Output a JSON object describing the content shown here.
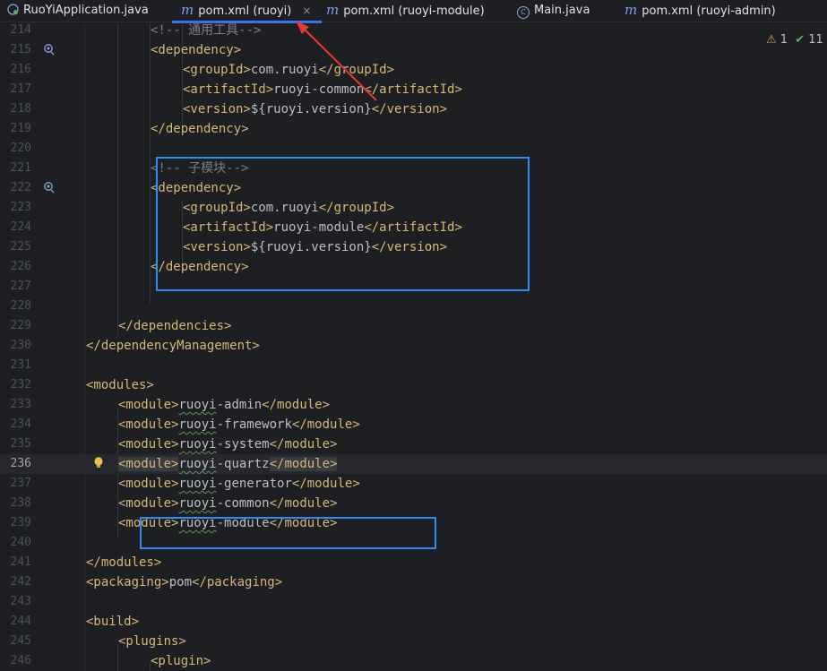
{
  "tabs": [
    {
      "label": "RuoYiApplication.java",
      "icon": "spring-java-class-icon"
    },
    {
      "label": "pom.xml (ruoyi)",
      "icon": "maven-m-icon",
      "active": true,
      "close": "×"
    },
    {
      "label": "pom.xml (ruoyi-module)",
      "icon": "maven-m-icon"
    },
    {
      "label": "Main.java",
      "icon": "java-class-c-icon",
      "glyph": "C"
    },
    {
      "label": "pom.xml (ruoyi-admin)",
      "icon": "maven-m-icon"
    }
  ],
  "inspection": {
    "warnings": "1",
    "ok": "11"
  },
  "lines": [
    {
      "n": "214",
      "text": "<!-- 通用工具-->"
    },
    {
      "n": "215",
      "text": "<dependency>"
    },
    {
      "n": "216",
      "text": "<groupId>com.ruoyi</groupId>"
    },
    {
      "n": "217",
      "text": "<artifactId>ruoyi-common</artifactId>"
    },
    {
      "n": "218",
      "text": "<version>${ruoyi.version}</version>"
    },
    {
      "n": "219",
      "text": "</dependency>"
    },
    {
      "n": "220",
      "text": ""
    },
    {
      "n": "221",
      "text": "<!-- 子模块-->"
    },
    {
      "n": "222",
      "text": "<dependency>"
    },
    {
      "n": "223",
      "text": "<groupId>com.ruoyi</groupId>"
    },
    {
      "n": "224",
      "text": "<artifactId>ruoyi-module</artifactId>"
    },
    {
      "n": "225",
      "text": "<version>${ruoyi.version}</version>"
    },
    {
      "n": "226",
      "text": "</dependency>"
    },
    {
      "n": "227",
      "text": ""
    },
    {
      "n": "228",
      "text": ""
    },
    {
      "n": "229",
      "text": "</dependencies>"
    },
    {
      "n": "230",
      "text": "</dependencyManagement>"
    },
    {
      "n": "231",
      "text": ""
    },
    {
      "n": "232",
      "text": "<modules>"
    },
    {
      "n": "233",
      "text": "<module>ruoyi-admin</module>"
    },
    {
      "n": "234",
      "text": "<module>ruoyi-framework</module>"
    },
    {
      "n": "235",
      "text": "<module>ruoyi-system</module>"
    },
    {
      "n": "236",
      "text": "<module>ruoyi-quartz</module>"
    },
    {
      "n": "237",
      "text": "<module>ruoyi-generator</module>"
    },
    {
      "n": "238",
      "text": "<module>ruoyi-common</module>"
    },
    {
      "n": "239",
      "text": "<module>ruoyi-module</module>"
    },
    {
      "n": "240",
      "text": ""
    },
    {
      "n": "241",
      "text": "</modules>"
    },
    {
      "n": "242",
      "text": "<packaging>pom</packaging>"
    },
    {
      "n": "243",
      "text": ""
    },
    {
      "n": "244",
      "text": "<build>"
    },
    {
      "n": "245",
      "text": "<plugins>"
    },
    {
      "n": "246",
      "text": "<plugin>"
    }
  ],
  "colors": {
    "background": "#1e1f22",
    "tag": "#d5b778",
    "comment": "#7a7e85",
    "text": "#bcbec4",
    "active_tab_underline": "#3574f0",
    "annotation_box": "#2e8ef0",
    "annotation_arrow": "#e53935"
  }
}
